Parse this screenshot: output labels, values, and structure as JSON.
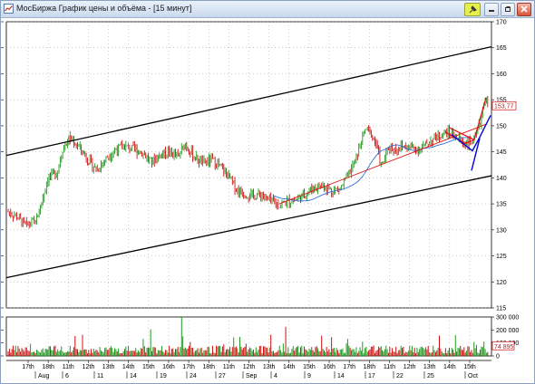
{
  "window": {
    "title": "МосБиржа График цены и объёма - [15 минут]",
    "buttons": {
      "pin": "pin-icon",
      "minimize": "minimize-icon",
      "restore": "restore-icon",
      "close": "close-icon"
    }
  },
  "colors": {
    "price_up": "#1f9a1f",
    "price_down": "#d01010",
    "channel": "#000000",
    "trend_red": "#e01010",
    "trend_blue": "#1010d0",
    "moving_average": "#2f6fdf",
    "grid": "#9a9a9a"
  },
  "chart_data": [
    {
      "type": "candlestick",
      "title": "",
      "ylim": [
        115,
        170
      ],
      "y_ticks": [
        "170",
        "165",
        "160",
        "155",
        "150",
        "145",
        "140",
        "135",
        "130",
        "125",
        "120",
        "115"
      ],
      "grid": "dotted",
      "price_label": "153,77",
      "close_points": [
        [
          0,
          133.5
        ],
        [
          10,
          132.5
        ],
        [
          20,
          130.8
        ],
        [
          32,
          131.8
        ],
        [
          45,
          140
        ],
        [
          55,
          141
        ],
        [
          62,
          145.8
        ],
        [
          70,
          147.5
        ],
        [
          80,
          146
        ],
        [
          90,
          143.5
        ],
        [
          100,
          141.5
        ],
        [
          112,
          144
        ],
        [
          122,
          145.5
        ],
        [
          132,
          146
        ],
        [
          142,
          145.5
        ],
        [
          152,
          144.8
        ],
        [
          162,
          143
        ],
        [
          172,
          144.5
        ],
        [
          182,
          145
        ],
        [
          192,
          144
        ],
        [
          200,
          146.5
        ],
        [
          210,
          144
        ],
        [
          220,
          142.8
        ],
        [
          230,
          143.5
        ],
        [
          240,
          142
        ],
        [
          250,
          140
        ],
        [
          258,
          137.8
        ],
        [
          266,
          137
        ],
        [
          276,
          136.5
        ],
        [
          286,
          136.8
        ],
        [
          296,
          135.5
        ],
        [
          306,
          134.8
        ],
        [
          316,
          135.5
        ],
        [
          326,
          135.8
        ],
        [
          336,
          137
        ],
        [
          346,
          138.2
        ],
        [
          356,
          138.5
        ],
        [
          366,
          137.5
        ],
        [
          376,
          138
        ],
        [
          384,
          140.5
        ],
        [
          392,
          143
        ],
        [
          398,
          146.5
        ],
        [
          404,
          149.5
        ],
        [
          410,
          148.5
        ],
        [
          416,
          146.5
        ],
        [
          422,
          142
        ],
        [
          430,
          146
        ],
        [
          438,
          145.5
        ],
        [
          446,
          146
        ],
        [
          456,
          145.8
        ],
        [
          466,
          145.5
        ],
        [
          476,
          147
        ],
        [
          486,
          148
        ],
        [
          496,
          148.8
        ],
        [
          504,
          148.2
        ],
        [
          512,
          147
        ],
        [
          520,
          146.5
        ],
        [
          528,
          147.5
        ],
        [
          534,
          151
        ],
        [
          538,
          155.5
        ],
        [
          542,
          153.77
        ]
      ],
      "volume_ylim": [
        0,
        300000
      ],
      "volume_ticks": [
        "300 000",
        "200 000",
        "100 000",
        "0"
      ],
      "volume_label": "74 895",
      "x_ticks": [
        "17th",
        "18th",
        "11th",
        "12th",
        "13th",
        "14th",
        "15th",
        "16th",
        "17th",
        "18th",
        "11th",
        "12th",
        "13th",
        "14th",
        "15th",
        "16th",
        "17th",
        "18th",
        "11th",
        "12th",
        "13th",
        "14th",
        "15th"
      ],
      "x_dates": [
        "Aug",
        "6",
        "11",
        "14",
        "19",
        "24",
        "27",
        "Sep",
        "4",
        "9",
        "14",
        "17",
        "22",
        "25",
        "Oct"
      ]
    }
  ]
}
